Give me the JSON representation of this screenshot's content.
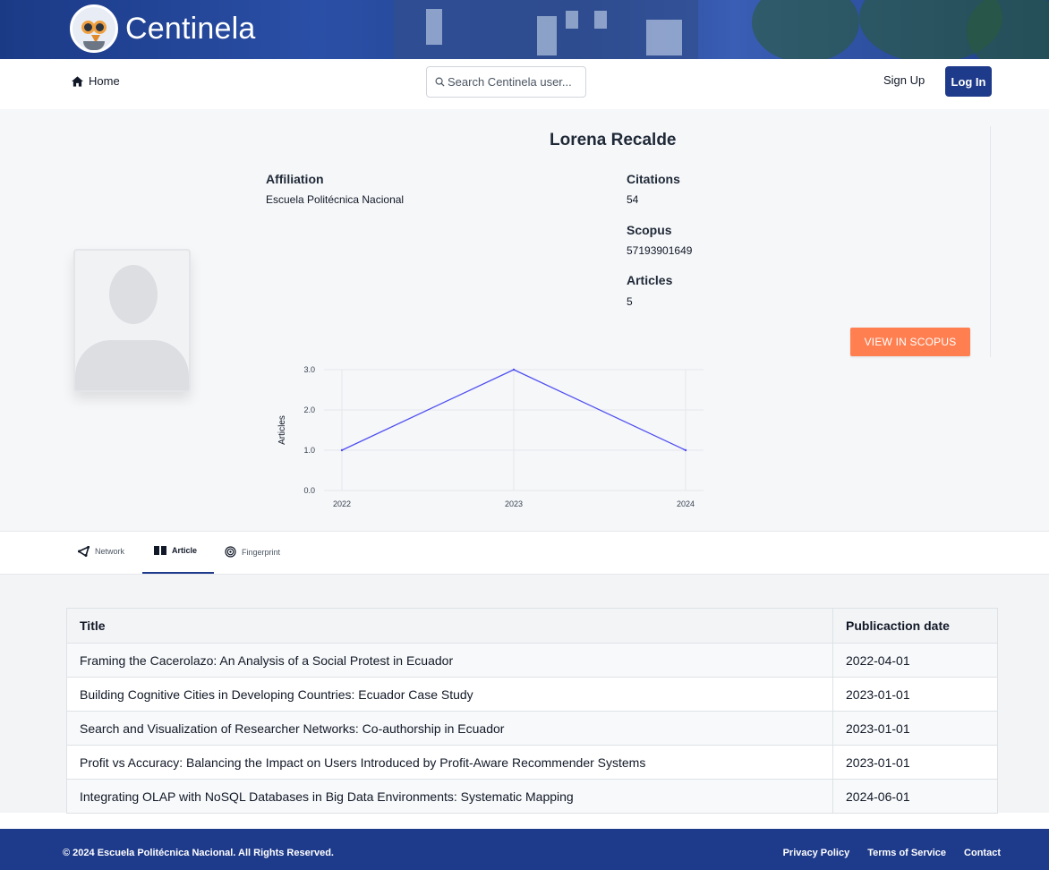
{
  "brand": {
    "name": "Centinela"
  },
  "nav": {
    "home_label": "Home",
    "search_placeholder": "Search Centinela user...",
    "signup_label": "Sign Up",
    "login_label": "Log In"
  },
  "profile": {
    "name": "Lorena Recalde",
    "affiliation_label": "Affiliation",
    "affiliation_value": "Escuela Politécnica Nacional",
    "citations_label": "Citations",
    "citations_value": "54",
    "scopus_label": "Scopus",
    "scopus_value": "57193901649",
    "articles_label": "Articles",
    "articles_value": "5",
    "view_scopus_label": "VIEW IN SCOPUS"
  },
  "chart_data": {
    "type": "line",
    "x": [
      "2022",
      "2023",
      "2024"
    ],
    "series": [
      {
        "values": [
          1,
          3,
          1
        ],
        "color": "#4f4ff0"
      }
    ],
    "ylabel": "Articles",
    "xlabel": "",
    "ylim": [
      0,
      3
    ],
    "yticks": [
      "0.0",
      "1.0",
      "2.0",
      "3.0"
    ],
    "grid": true
  },
  "tabs": [
    {
      "label": "Network",
      "icon": "network-icon"
    },
    {
      "label": "Article",
      "icon": "book-icon"
    },
    {
      "label": "Fingerprint",
      "icon": "fingerprint-icon"
    }
  ],
  "table": {
    "headers": {
      "title": "Title",
      "date": "Publicaction date"
    },
    "rows": [
      {
        "title": "Framing the Cacerolazo: An Analysis of a Social Protest in Ecuador",
        "date": "2022-04-01"
      },
      {
        "title": "Building Cognitive Cities in Developing Countries: Ecuador Case Study",
        "date": "2023-01-01"
      },
      {
        "title": "Search and Visualization of Researcher Networks: Co-authorship in Ecuador",
        "date": "2023-01-01"
      },
      {
        "title": "Profit vs Accuracy: Balancing the Impact on Users Introduced by Profit-Aware Recommender Systems",
        "date": "2023-01-01"
      },
      {
        "title": "Integrating OLAP with NoSQL Databases in Big Data Environments: Systematic Mapping",
        "date": "2024-06-01"
      }
    ]
  },
  "footer": {
    "copyright": "© 2024 Escuela Politécnica Nacional. All Rights Reserved.",
    "privacy": "Privacy Policy",
    "terms": "Terms of Service",
    "contact": "Contact"
  },
  "colors": {
    "primary": "#1e3a8a",
    "accent": "#ff7f50",
    "line": "#4f4ff0"
  }
}
